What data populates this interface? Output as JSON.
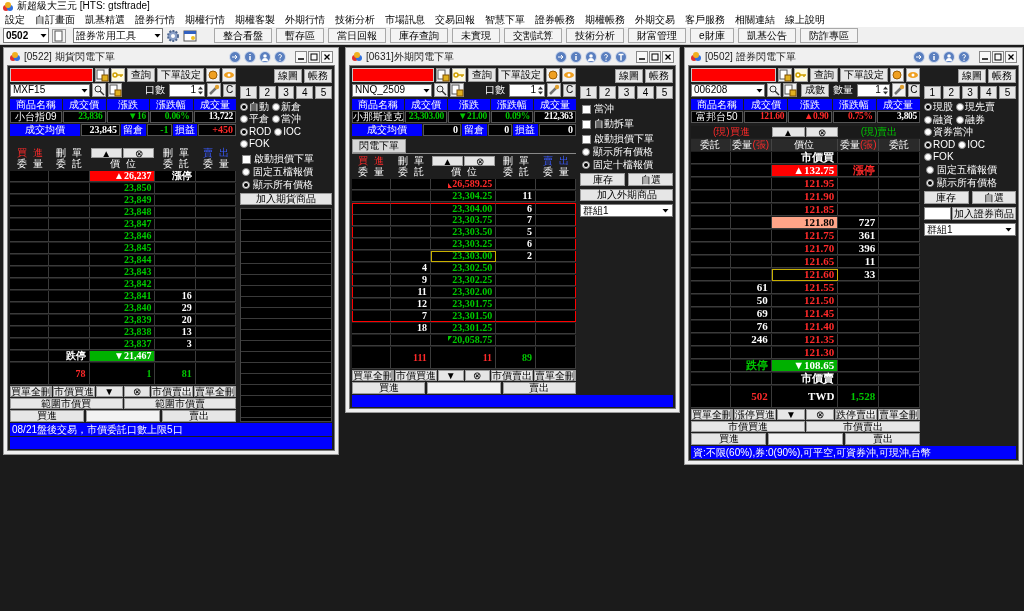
{
  "app_title": "新超級大三元 [HTS: gtsftrade]",
  "menu": [
    "設定",
    "自訂畫面",
    "凱基精選",
    "證券行情",
    "期權行情",
    "期權客製",
    "外期行情",
    "技術分析",
    "市場訊息",
    "交易回報",
    "智慧下單",
    "證券帳務",
    "期權帳務",
    "外期交易",
    "客戶服務",
    "相關連結",
    "線上說明"
  ],
  "toolbar": {
    "account": "0502",
    "tools": "證券常用工具",
    "buttons": [
      "整合看盤",
      "暫存區",
      "當日回報",
      "庫存查詢",
      "未實現",
      "交割試算",
      "技術分析",
      "財富管理",
      "e財庫",
      "凱基公告",
      "防詐專區"
    ]
  },
  "windows": [
    {
      "kind": "futures",
      "title": "[0522] 期貨閃電下單",
      "symbol": "MXF15",
      "query_button": "查詢",
      "settings_button": "下單設定",
      "quantity_label": "口數",
      "quantity": "1",
      "clear_button": "C",
      "chart_button": "線圖",
      "account_button": "帳務",
      "presets": [
        "1",
        "2",
        "3",
        "4",
        "5"
      ],
      "quote": {
        "headers": [
          "商品名稱",
          "成交價",
          "漲跌",
          "漲跌幅",
          "成交量"
        ],
        "values": [
          {
            "text": "小台指09",
            "kind": "plain"
          },
          {
            "text": "23,836",
            "kind": "down"
          },
          {
            "text": "▼16",
            "kind": "down"
          },
          {
            "text": "0.06%",
            "kind": "down"
          },
          {
            "text": "13,722",
            "kind": "plain"
          }
        ]
      },
      "summary": [
        {
          "kind": "label",
          "text": "成交均價"
        },
        {
          "kind": "plain",
          "text": "23,845"
        },
        {
          "kind": "label",
          "text": "留倉"
        },
        {
          "kind": "down",
          "text": "-1"
        },
        {
          "kind": "label",
          "text": "損益"
        },
        {
          "kind": "up",
          "text": "+450"
        }
      ],
      "ladder_header": {
        "kind": "stacked",
        "buttons": [
          "▲",
          "⊗"
        ],
        "columns": [
          {
            "top": "買進",
            "bottom": "委量"
          },
          {
            "top": "刪單",
            "bottom": "委託"
          },
          {
            "bottom": "價位"
          },
          {
            "top": "刪單",
            "bottom": "委託"
          },
          {
            "top": "賣出",
            "bottom": "委量"
          }
        ]
      },
      "rows": [
        {
          "kind": "limit_up",
          "current": false,
          "price": {
            "text": "▲26,237",
            "kind": "plain"
          },
          "right_1": "漲停"
        },
        {
          "kind": "level",
          "current": false,
          "price": {
            "text": "23,850",
            "kind": "down"
          }
        },
        {
          "kind": "level",
          "current": false,
          "price": {
            "text": "23,849",
            "kind": "down"
          }
        },
        {
          "kind": "level",
          "current": false,
          "price": {
            "text": "23,848",
            "kind": "down"
          }
        },
        {
          "kind": "level",
          "current": false,
          "price": {
            "text": "23,847",
            "kind": "down"
          }
        },
        {
          "kind": "level",
          "current": false,
          "price": {
            "text": "23,846",
            "kind": "down"
          }
        },
        {
          "kind": "level",
          "current": false,
          "price": {
            "text": "23,845",
            "kind": "down"
          }
        },
        {
          "kind": "level",
          "current": false,
          "price": {
            "text": "23,844",
            "kind": "down"
          }
        },
        {
          "kind": "level",
          "current": false,
          "price": {
            "text": "23,843",
            "kind": "down"
          }
        },
        {
          "kind": "level",
          "current": false,
          "price": {
            "text": "23,842",
            "kind": "down"
          }
        },
        {
          "kind": "level",
          "current": false,
          "price": {
            "text": "23,841",
            "kind": "down"
          },
          "right_1": "16"
        },
        {
          "kind": "level",
          "current": false,
          "price": {
            "text": "23,840",
            "kind": "down"
          },
          "right_1": "29"
        },
        {
          "kind": "level",
          "current": false,
          "price": {
            "text": "23,839",
            "kind": "down"
          },
          "right_1": "20"
        },
        {
          "kind": "level",
          "current": false,
          "price": {
            "text": "23,838",
            "kind": "down"
          },
          "right_1": "13"
        },
        {
          "kind": "level",
          "current": false,
          "price": {
            "text": "23,837",
            "kind": "down"
          },
          "right_1": "3"
        },
        {
          "kind": "limit_down",
          "current": false,
          "left_2": "跌停",
          "price": {
            "text": "▼21,467",
            "kind": "plain"
          }
        },
        {
          "kind": "totals",
          "current": false,
          "left_2": {
            "text": "78",
            "kind": "up"
          },
          "price": {
            "text": "1",
            "kind": "down"
          },
          "right_1": {
            "text": "81",
            "kind": "down"
          }
        }
      ],
      "action_rows": [
        {
          "kind": "buttons",
          "labels": [
            "買單全刪",
            "市價買進",
            "▼",
            "⊗",
            "市價賣出",
            "賣單全刪"
          ]
        },
        {
          "kind": "buttons",
          "labels": [
            "範圍市價買",
            "範圍市價賣"
          ]
        },
        {
          "kind": "order",
          "buy": "買進",
          "sell": "賣出"
        }
      ],
      "status": "08/21盤後交易，市價委託口數上限5口",
      "side": [
        {
          "kind": "radio_row",
          "options": [
            {
              "label": "自動",
              "selected": true
            },
            {
              "label": "新倉",
              "selected": false
            },
            {
              "label": "平倉",
              "selected": false
            },
            {
              "label": "當沖",
              "selected": false
            }
          ]
        },
        {
          "kind": "radio_row",
          "options": [
            {
              "label": "ROD",
              "selected": true
            },
            {
              "label": "IOC",
              "selected": false
            },
            {
              "label": "FOK",
              "selected": false
            }
          ]
        },
        {
          "kind": "checkbox",
          "label": "啟動損價下單",
          "checked": false
        },
        {
          "kind": "radio",
          "label": "固定五檔報價",
          "selected": false
        },
        {
          "kind": "radio",
          "label": "顯示所有價格",
          "selected": true
        },
        {
          "kind": "button",
          "label": "加入期貨商品"
        }
      ]
    },
    {
      "kind": "foreign",
      "title": "[0631]外期閃電下單",
      "symbol": "NNQ_2509",
      "query_button": "查詢",
      "settings_button": "下單設定",
      "quantity_label": "口數",
      "quantity": "1",
      "clear_button": "C",
      "chart_button": "線圖",
      "account_button": "帳務",
      "presets": [
        "1",
        "2",
        "3",
        "4",
        "5"
      ],
      "quote": {
        "headers": [
          "商品名稱",
          "成交價",
          "漲跌",
          "漲跌幅",
          "成交量"
        ],
        "values": [
          {
            "text": "小那斯達克",
            "kind": "plain"
          },
          {
            "text": "23,303.00",
            "kind": "down"
          },
          {
            "text": "▼21.00",
            "kind": "down"
          },
          {
            "text": "0.09%",
            "kind": "down"
          },
          {
            "text": "212,363",
            "kind": "plain"
          }
        ]
      },
      "summary": [
        {
          "kind": "label",
          "text": "成交均價"
        },
        {
          "kind": "plain",
          "text": "0"
        },
        {
          "kind": "label",
          "text": "留倉"
        },
        {
          "kind": "plain",
          "text": "0"
        },
        {
          "kind": "label",
          "text": "損益"
        },
        {
          "kind": "plain",
          "text": "0"
        }
      ],
      "tab": "閃電下單",
      "ladder_header": {
        "kind": "stacked",
        "buttons": [
          "▲",
          "⊗"
        ],
        "columns": [
          {
            "top": "買進",
            "bottom": "委量"
          },
          {
            "top": "刪單",
            "bottom": "委託"
          },
          {
            "bottom": "價位"
          },
          {
            "top": "刪單",
            "bottom": "委託"
          },
          {
            "top": "賣出",
            "bottom": "委量"
          }
        ]
      },
      "rows": [
        {
          "kind": "limit_up_flag",
          "current": false,
          "in_range": false,
          "price": {
            "text": "26,589.25",
            "kind": "up"
          }
        },
        {
          "kind": "level",
          "current": false,
          "in_range": false,
          "price": {
            "text": "23,304.25",
            "kind": "down"
          },
          "right_1": "11"
        },
        {
          "kind": "level",
          "current": false,
          "in_range": true,
          "price": {
            "text": "23,304.00",
            "kind": "down"
          },
          "right_1": "6"
        },
        {
          "kind": "level",
          "current": false,
          "in_range": true,
          "price": {
            "text": "23,303.75",
            "kind": "down"
          },
          "right_1": "7"
        },
        {
          "kind": "level",
          "current": false,
          "in_range": true,
          "price": {
            "text": "23,303.50",
            "kind": "down"
          },
          "right_1": "5"
        },
        {
          "kind": "level",
          "current": false,
          "in_range": true,
          "price": {
            "text": "23,303.25",
            "kind": "down"
          },
          "right_1": "6"
        },
        {
          "kind": "level",
          "current": true,
          "in_range": true,
          "price": {
            "text": "23,303.00",
            "kind": "down"
          },
          "right_1": "2"
        },
        {
          "kind": "level",
          "current": false,
          "in_range": true,
          "left_2": "4",
          "price": {
            "text": "23,302.50",
            "kind": "down"
          }
        },
        {
          "kind": "level",
          "current": false,
          "in_range": true,
          "left_2": "9",
          "price": {
            "text": "23,302.25",
            "kind": "down"
          }
        },
        {
          "kind": "level",
          "current": false,
          "in_range": true,
          "left_2": "11",
          "price": {
            "text": "23,302.00",
            "kind": "down"
          }
        },
        {
          "kind": "level",
          "current": false,
          "in_range": true,
          "left_2": "12",
          "price": {
            "text": "23,301.75",
            "kind": "down"
          }
        },
        {
          "kind": "level",
          "current": false,
          "in_range": true,
          "left_2": "7",
          "price": {
            "text": "23,301.50",
            "kind": "down"
          }
        },
        {
          "kind": "level",
          "current": false,
          "in_range": false,
          "left_2": "18",
          "price": {
            "text": "23,301.25",
            "kind": "down"
          }
        },
        {
          "kind": "limit_down_flag",
          "current": false,
          "in_range": false,
          "price": {
            "text": "20,058.75",
            "kind": "down"
          }
        },
        {
          "kind": "totals",
          "current": false,
          "in_range": false,
          "left_2": {
            "text": "111",
            "kind": "up"
          },
          "price": {
            "text": "11",
            "kind": "up"
          },
          "right_1": {
            "text": "89",
            "kind": "down"
          }
        }
      ],
      "action_rows": [
        {
          "kind": "buttons",
          "labels": [
            "買單全刪",
            "市價買進",
            "▼",
            "⊗",
            "市價賣出",
            "賣單全刪"
          ]
        },
        {
          "kind": "order",
          "buy": "買進",
          "sell": "賣出"
        }
      ],
      "side": [
        {
          "kind": "checkbox",
          "label": "當沖",
          "checked": false
        },
        {
          "kind": "checkbox",
          "label": "自動拆單",
          "checked": false
        },
        {
          "kind": "checkbox",
          "label": "啟動損價下單",
          "checked": false
        },
        {
          "kind": "radio",
          "label": "顯示所有價格",
          "selected": false
        },
        {
          "kind": "radio",
          "label": "固定十檔報價",
          "selected": true
        },
        {
          "kind": "button_pair",
          "labels": [
            "庫存",
            "自選"
          ]
        },
        {
          "kind": "button",
          "label": "加入外期商品"
        },
        {
          "kind": "dropdown",
          "value": "群組1"
        }
      ]
    },
    {
      "kind": "stock",
      "title": "[0502] 證券閃電下單",
      "symbol": "006208",
      "query_button": "查詢",
      "settings_button": "下單設定",
      "ratio_button": "成數",
      "quantity_label": "數量",
      "quantity": "1",
      "clear_button": "C",
      "chart_button": "線圖",
      "account_button": "帳務",
      "presets": [
        "1",
        "2",
        "3",
        "4",
        "5"
      ],
      "quote": {
        "headers": [
          "商品名稱",
          "成交價",
          "漲跌",
          "漲跌幅",
          "成交量"
        ],
        "values": [
          {
            "text": "富邦台50",
            "kind": "plain"
          },
          {
            "text": "121.60",
            "kind": "up"
          },
          {
            "text": "▲0.90",
            "kind": "up"
          },
          {
            "text": "0.75%",
            "kind": "up"
          },
          {
            "text": "3,805",
            "kind": "plain"
          }
        ]
      },
      "ladder_header": {
        "kind": "grouped",
        "buy_group": "(現)買進",
        "sell_group": "(現)賣出",
        "buttons": [
          "▲",
          "⊗"
        ],
        "columns": [
          {
            "text": "委託"
          },
          {
            "text": "委量",
            "unit": "(張)"
          },
          {
            "text": "價位"
          },
          {
            "text": "委量",
            "unit": "(張)"
          },
          {
            "text": "委託"
          }
        ]
      },
      "rows": [
        {
          "kind": "level",
          "current": false,
          "price": {
            "text": "市價買",
            "kind": "plain"
          }
        },
        {
          "kind": "limit_up",
          "current": false,
          "price": {
            "text": "▲132.75",
            "kind": "plain"
          },
          "right_1": {
            "text": "漲停",
            "kind": "up"
          }
        },
        {
          "kind": "level",
          "current": false,
          "price": {
            "text": "121.95",
            "kind": "up"
          }
        },
        {
          "kind": "level",
          "current": false,
          "price": {
            "text": "121.90",
            "kind": "up"
          }
        },
        {
          "kind": "level",
          "current": false,
          "price": {
            "text": "121.85",
            "kind": "up"
          }
        },
        {
          "kind": "last_trade",
          "current": false,
          "price": {
            "text": "121.80",
            "kind": "dark"
          },
          "right_1": "727"
        },
        {
          "kind": "level",
          "current": false,
          "price": {
            "text": "121.75",
            "kind": "up"
          },
          "right_1": "361"
        },
        {
          "kind": "level",
          "current": false,
          "price": {
            "text": "121.70",
            "kind": "up"
          },
          "right_1": "396"
        },
        {
          "kind": "level",
          "current": false,
          "price": {
            "text": "121.65",
            "kind": "up"
          },
          "right_1": "11"
        },
        {
          "kind": "level",
          "current": true,
          "price": {
            "text": "121.60",
            "kind": "up"
          },
          "right_1": "33"
        },
        {
          "kind": "level",
          "current": false,
          "left_2": "61",
          "price": {
            "text": "121.55",
            "kind": "up"
          }
        },
        {
          "kind": "level",
          "current": false,
          "left_2": "50",
          "price": {
            "text": "121.50",
            "kind": "up"
          }
        },
        {
          "kind": "level",
          "current": false,
          "left_2": "69",
          "price": {
            "text": "121.45",
            "kind": "up"
          }
        },
        {
          "kind": "level",
          "current": false,
          "left_2": "76",
          "price": {
            "text": "121.40",
            "kind": "up"
          }
        },
        {
          "kind": "level",
          "current": false,
          "left_2": "246",
          "price": {
            "text": "121.35",
            "kind": "up"
          }
        },
        {
          "kind": "level",
          "current": false,
          "price": {
            "text": "121.30",
            "kind": "up"
          }
        },
        {
          "kind": "limit_down",
          "current": false,
          "left_2": {
            "text": "跌停",
            "kind": "down"
          },
          "price": {
            "text": "▼108.65",
            "kind": "plain"
          }
        },
        {
          "kind": "level",
          "current": false,
          "price": {
            "text": "市價賣",
            "kind": "plain"
          }
        },
        {
          "kind": "totals",
          "current": false,
          "left_2": {
            "text": "502",
            "kind": "up"
          },
          "price": {
            "text": "TWD",
            "kind": "plain"
          },
          "right_1": {
            "text": "1,528",
            "kind": "down"
          }
        }
      ],
      "action_rows": [
        {
          "kind": "buttons",
          "labels": [
            "買單全刪",
            "漲停買進",
            "▼",
            "⊗",
            "跌停賣出",
            "賣單全刪"
          ]
        },
        {
          "kind": "buttons",
          "labels": [
            "市價買進",
            "市價賣出"
          ]
        },
        {
          "kind": "order",
          "buy": "買進",
          "sell": "賣出"
        }
      ],
      "status": "資:不限(60%),券:0(90%),可平空,可資券沖,可現沖,台幣",
      "side": [
        {
          "kind": "radio_row",
          "options": [
            {
              "label": "現股",
              "selected": true
            },
            {
              "label": "現先賣",
              "selected": false
            }
          ]
        },
        {
          "kind": "radio_row",
          "options": [
            {
              "label": "融資",
              "selected": false
            },
            {
              "label": "融券",
              "selected": false
            },
            {
              "label": "資券當沖",
              "selected": false
            }
          ]
        },
        {
          "kind": "radio_row",
          "options": [
            {
              "label": "ROD",
              "selected": true
            },
            {
              "label": "IOC",
              "selected": false
            },
            {
              "label": "FOK",
              "selected": false
            }
          ]
        },
        {
          "kind": "radio",
          "label": "固定五檔報價",
          "selected": false
        },
        {
          "kind": "radio",
          "label": "顯示所有價格",
          "selected": true
        },
        {
          "kind": "button_pair",
          "labels": [
            "庫存",
            "自選"
          ]
        },
        {
          "kind": "input_button",
          "label": "加入證券商品"
        },
        {
          "kind": "dropdown",
          "value": "群組1"
        }
      ]
    }
  ]
}
